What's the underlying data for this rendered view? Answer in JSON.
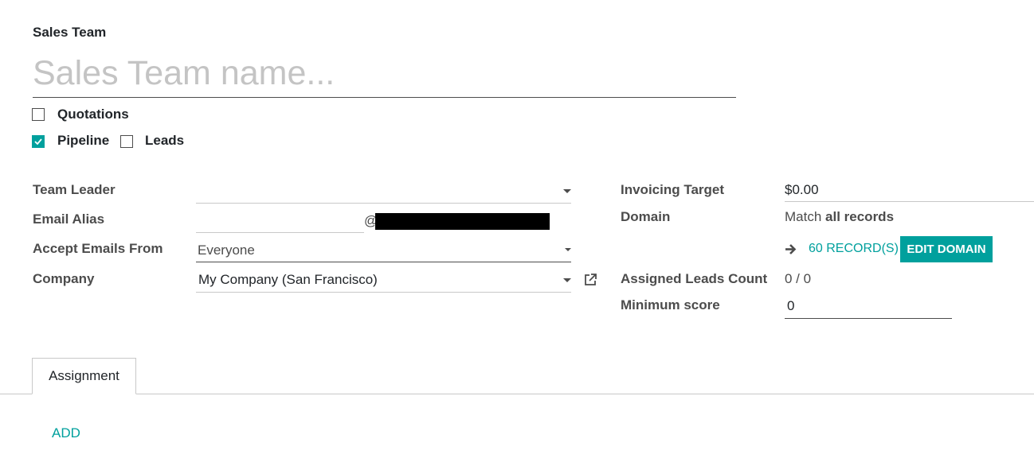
{
  "form": {
    "title_label": "Sales Team",
    "name_placeholder": "Sales Team name...",
    "name_value": "",
    "options": {
      "quotations": {
        "label": "Quotations",
        "checked": false
      },
      "pipeline": {
        "label": "Pipeline",
        "checked": true
      },
      "leads": {
        "label": "Leads",
        "checked": false
      }
    }
  },
  "left_fields": {
    "team_leader": {
      "label": "Team Leader",
      "value": ""
    },
    "email_alias": {
      "label": "Email Alias",
      "at": "@"
    },
    "accept_emails_from": {
      "label": "Accept Emails From",
      "value": "Everyone"
    },
    "company": {
      "label": "Company",
      "value": "My Company (San Francisco)"
    }
  },
  "right_fields": {
    "invoicing_target": {
      "label": "Invoicing Target",
      "value": "$0.00"
    },
    "domain": {
      "label": "Domain",
      "prefix": "Match ",
      "value": "all records"
    },
    "records_link": "60 RECORD(S)",
    "edit_domain_button": "EDIT DOMAIN",
    "assigned_leads_count": {
      "label": "Assigned Leads Count",
      "value": "0 / 0"
    },
    "minimum_score": {
      "label": "Minimum score",
      "value": "0"
    }
  },
  "tabs": [
    {
      "label": "Assignment",
      "active": true
    }
  ],
  "assignment": {
    "add_label": "ADD"
  },
  "colors": {
    "accent": "#00a09d",
    "label": "#4c4c4c",
    "text": "#212529"
  }
}
